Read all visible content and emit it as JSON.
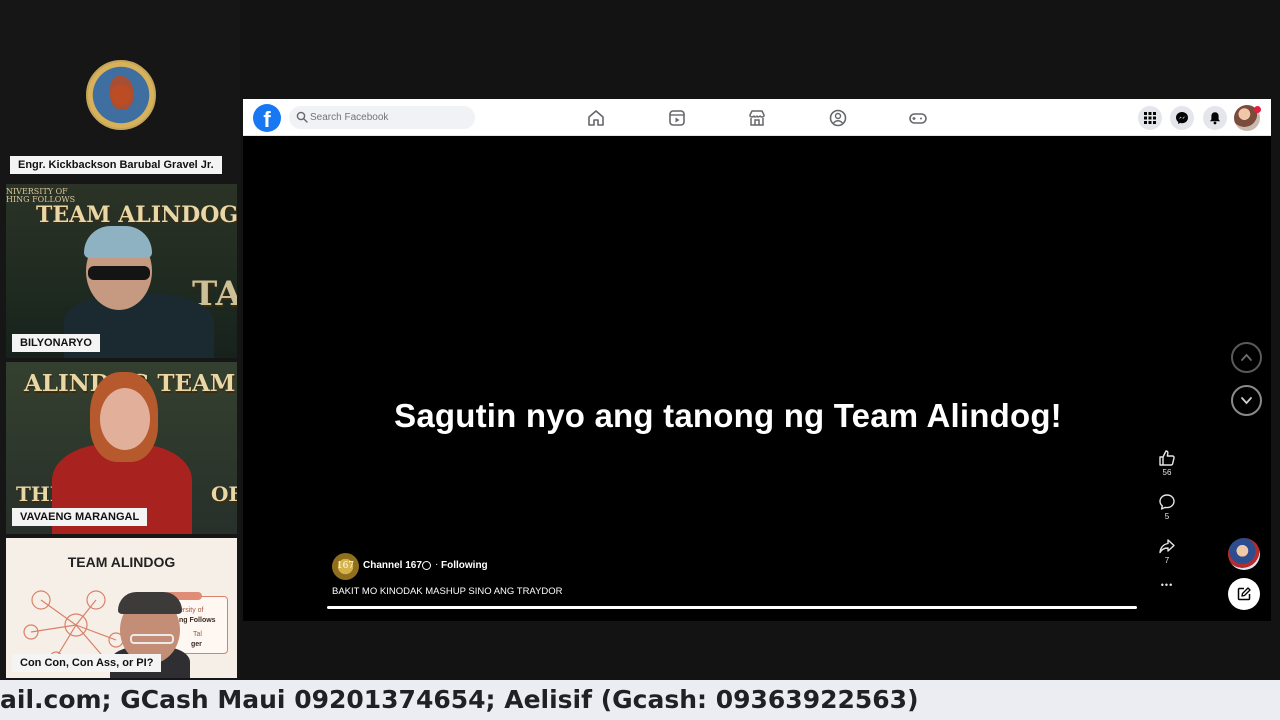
{
  "participants": [
    {
      "name": "Engr. Kickbackson Barubal Gravel Jr."
    },
    {
      "name": "BILYONARYO",
      "banner": "TEAM ALINDOG",
      "banner_small": "NIVERSITY OF",
      "banner_small2": "HING FOLLOWS",
      "backdrop": "TA"
    },
    {
      "name": "VAVAENG MARANGAL",
      "banner": "ALINDOG TEAM",
      "backdrop_left": "THE",
      "backdrop_right": "OF"
    },
    {
      "name": "Con Con, Con Ass, or PI?",
      "slide_title": "TEAM ALINDOG",
      "slide_line1": "ersity of",
      "slide_line2": "ng Follows",
      "slide_line3": "Tal",
      "slide_line4": "ger"
    }
  ],
  "facebook": {
    "logo": "f",
    "search_placeholder": "Search Facebook",
    "nav": [
      "home-icon",
      "reels-icon",
      "marketplace-icon",
      "groups-icon",
      "gaming-icon"
    ],
    "right_buttons": [
      "menu-grid-icon",
      "messenger-icon",
      "bell-icon"
    ],
    "brand_color": "#1877f2"
  },
  "video": {
    "caption": "Sagutin nyo  ang tanong ng Team Alindog!",
    "channel_avatar_text": "167",
    "channel_name": "Channel 167",
    "separator": "·",
    "following": "Following",
    "title": "BAKIT MO KINODAK MASHUP SINO ANG TRAYDOR",
    "likes": "56",
    "comments": "5",
    "shares": "7",
    "more": "•••"
  },
  "ticker": {
    "text": "ail.com; GCash Maui 09201374654; Aelisif (Gcash: 09363922563)"
  }
}
